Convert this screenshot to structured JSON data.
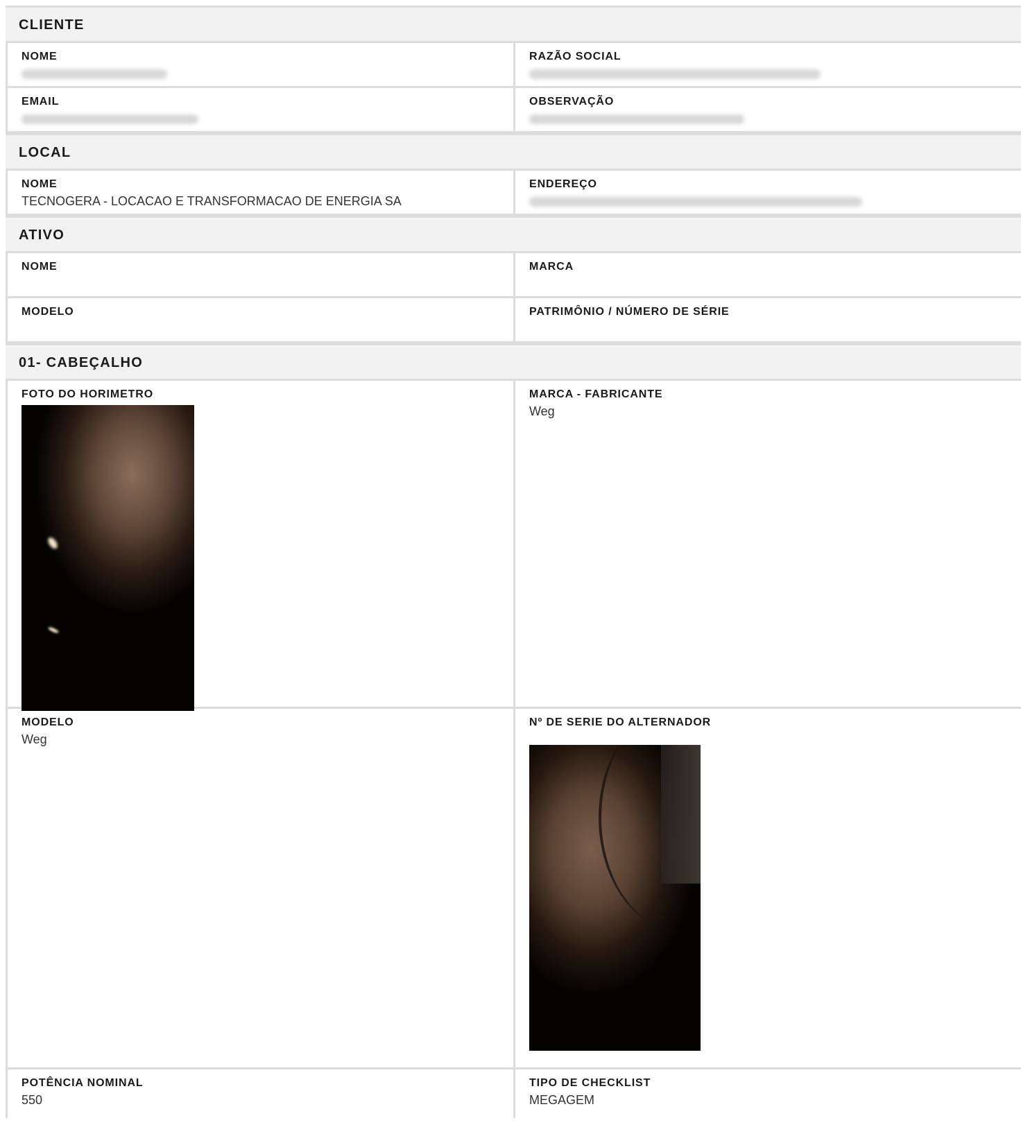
{
  "cliente": {
    "title": "CLIENTE",
    "nome_label": "NOME",
    "razao_label": "RAZÃO SOCIAL",
    "email_label": "EMAIL",
    "obs_label": "OBSERVAÇÃO"
  },
  "local": {
    "title": "LOCAL",
    "nome_label": "NOME",
    "nome_value": "TECNOGERA - LOCACAO E TRANSFORMACAO DE ENERGIA SA",
    "endereco_label": "ENDEREÇO"
  },
  "ativo": {
    "title": "ATIVO",
    "nome_label": "NOME",
    "marca_label": "MARCA",
    "modelo_label": "MODELO",
    "patrimonio_label": "PATRIMÔNIO / NÚMERO DE SÉRIE"
  },
  "cabecalho": {
    "title": "01- CABEÇALHO",
    "foto_label": "FOTO DO HORIMETRO",
    "marca_label": "MARCA - FABRICANTE",
    "marca_value": "Weg",
    "modelo_label": "MODELO",
    "modelo_value": "Weg",
    "serie_label": "Nº DE SERIE DO ALTERNADOR",
    "potencia_label": "POTÊNCIA NOMINAL",
    "potencia_value": "550",
    "tipo_label": "TIPO DE CHECKLIST",
    "tipo_value": "MEGAGEM"
  },
  "colors": {
    "header_bg": "#f2f2f2",
    "border": "#dcdcdc"
  }
}
